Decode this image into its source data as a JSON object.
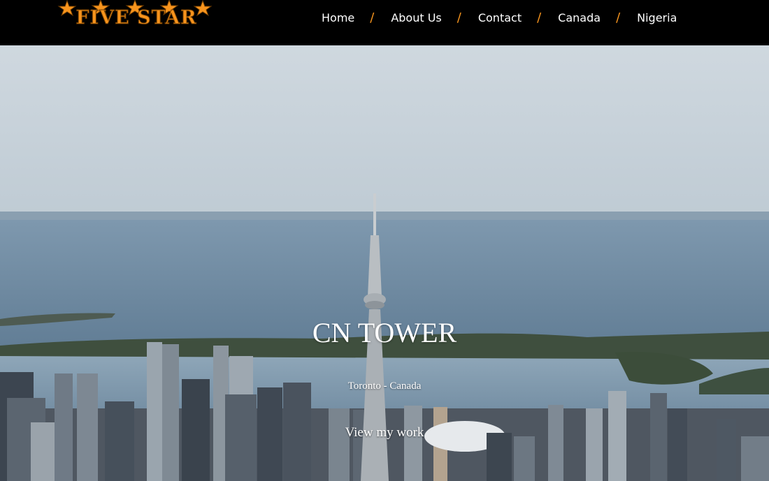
{
  "brand": {
    "logo_text": "FIVE STAR",
    "accent": "#f7941d"
  },
  "nav": {
    "items": [
      {
        "label": "Home"
      },
      {
        "label": "About Us"
      },
      {
        "label": "Contact"
      },
      {
        "label": "Canada"
      },
      {
        "label": "Nigeria"
      }
    ],
    "separator": "/"
  },
  "hero": {
    "title": "CN TOWER",
    "subtitle": "Toronto - Canada",
    "cta": "View my work"
  }
}
